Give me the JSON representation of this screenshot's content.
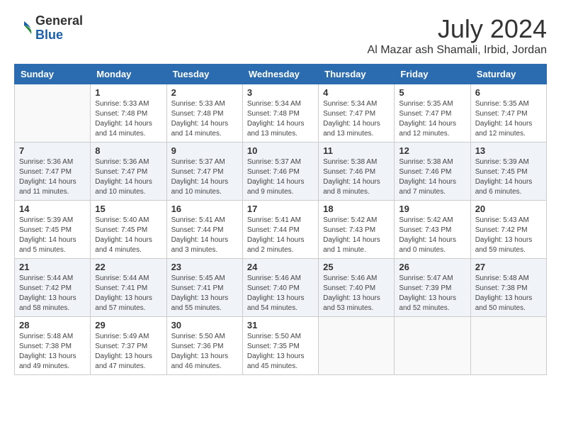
{
  "logo": {
    "general": "General",
    "blue": "Blue"
  },
  "header": {
    "month": "July 2024",
    "location": "Al Mazar ash Shamali, Irbid, Jordan"
  },
  "weekdays": [
    "Sunday",
    "Monday",
    "Tuesday",
    "Wednesday",
    "Thursday",
    "Friday",
    "Saturday"
  ],
  "weeks": [
    [
      {
        "day": "",
        "info": ""
      },
      {
        "day": "1",
        "info": "Sunrise: 5:33 AM\nSunset: 7:48 PM\nDaylight: 14 hours\nand 14 minutes."
      },
      {
        "day": "2",
        "info": "Sunrise: 5:33 AM\nSunset: 7:48 PM\nDaylight: 14 hours\nand 14 minutes."
      },
      {
        "day": "3",
        "info": "Sunrise: 5:34 AM\nSunset: 7:48 PM\nDaylight: 14 hours\nand 13 minutes."
      },
      {
        "day": "4",
        "info": "Sunrise: 5:34 AM\nSunset: 7:47 PM\nDaylight: 14 hours\nand 13 minutes."
      },
      {
        "day": "5",
        "info": "Sunrise: 5:35 AM\nSunset: 7:47 PM\nDaylight: 14 hours\nand 12 minutes."
      },
      {
        "day": "6",
        "info": "Sunrise: 5:35 AM\nSunset: 7:47 PM\nDaylight: 14 hours\nand 12 minutes."
      }
    ],
    [
      {
        "day": "7",
        "info": "Sunrise: 5:36 AM\nSunset: 7:47 PM\nDaylight: 14 hours\nand 11 minutes."
      },
      {
        "day": "8",
        "info": "Sunrise: 5:36 AM\nSunset: 7:47 PM\nDaylight: 14 hours\nand 10 minutes."
      },
      {
        "day": "9",
        "info": "Sunrise: 5:37 AM\nSunset: 7:47 PM\nDaylight: 14 hours\nand 10 minutes."
      },
      {
        "day": "10",
        "info": "Sunrise: 5:37 AM\nSunset: 7:46 PM\nDaylight: 14 hours\nand 9 minutes."
      },
      {
        "day": "11",
        "info": "Sunrise: 5:38 AM\nSunset: 7:46 PM\nDaylight: 14 hours\nand 8 minutes."
      },
      {
        "day": "12",
        "info": "Sunrise: 5:38 AM\nSunset: 7:46 PM\nDaylight: 14 hours\nand 7 minutes."
      },
      {
        "day": "13",
        "info": "Sunrise: 5:39 AM\nSunset: 7:45 PM\nDaylight: 14 hours\nand 6 minutes."
      }
    ],
    [
      {
        "day": "14",
        "info": "Sunrise: 5:39 AM\nSunset: 7:45 PM\nDaylight: 14 hours\nand 5 minutes."
      },
      {
        "day": "15",
        "info": "Sunrise: 5:40 AM\nSunset: 7:45 PM\nDaylight: 14 hours\nand 4 minutes."
      },
      {
        "day": "16",
        "info": "Sunrise: 5:41 AM\nSunset: 7:44 PM\nDaylight: 14 hours\nand 3 minutes."
      },
      {
        "day": "17",
        "info": "Sunrise: 5:41 AM\nSunset: 7:44 PM\nDaylight: 14 hours\nand 2 minutes."
      },
      {
        "day": "18",
        "info": "Sunrise: 5:42 AM\nSunset: 7:43 PM\nDaylight: 14 hours\nand 1 minute."
      },
      {
        "day": "19",
        "info": "Sunrise: 5:42 AM\nSunset: 7:43 PM\nDaylight: 14 hours\nand 0 minutes."
      },
      {
        "day": "20",
        "info": "Sunrise: 5:43 AM\nSunset: 7:42 PM\nDaylight: 13 hours\nand 59 minutes."
      }
    ],
    [
      {
        "day": "21",
        "info": "Sunrise: 5:44 AM\nSunset: 7:42 PM\nDaylight: 13 hours\nand 58 minutes."
      },
      {
        "day": "22",
        "info": "Sunrise: 5:44 AM\nSunset: 7:41 PM\nDaylight: 13 hours\nand 57 minutes."
      },
      {
        "day": "23",
        "info": "Sunrise: 5:45 AM\nSunset: 7:41 PM\nDaylight: 13 hours\nand 55 minutes."
      },
      {
        "day": "24",
        "info": "Sunrise: 5:46 AM\nSunset: 7:40 PM\nDaylight: 13 hours\nand 54 minutes."
      },
      {
        "day": "25",
        "info": "Sunrise: 5:46 AM\nSunset: 7:40 PM\nDaylight: 13 hours\nand 53 minutes."
      },
      {
        "day": "26",
        "info": "Sunrise: 5:47 AM\nSunset: 7:39 PM\nDaylight: 13 hours\nand 52 minutes."
      },
      {
        "day": "27",
        "info": "Sunrise: 5:48 AM\nSunset: 7:38 PM\nDaylight: 13 hours\nand 50 minutes."
      }
    ],
    [
      {
        "day": "28",
        "info": "Sunrise: 5:48 AM\nSunset: 7:38 PM\nDaylight: 13 hours\nand 49 minutes."
      },
      {
        "day": "29",
        "info": "Sunrise: 5:49 AM\nSunset: 7:37 PM\nDaylight: 13 hours\nand 47 minutes."
      },
      {
        "day": "30",
        "info": "Sunrise: 5:50 AM\nSunset: 7:36 PM\nDaylight: 13 hours\nand 46 minutes."
      },
      {
        "day": "31",
        "info": "Sunrise: 5:50 AM\nSunset: 7:35 PM\nDaylight: 13 hours\nand 45 minutes."
      },
      {
        "day": "",
        "info": ""
      },
      {
        "day": "",
        "info": ""
      },
      {
        "day": "",
        "info": ""
      }
    ]
  ]
}
